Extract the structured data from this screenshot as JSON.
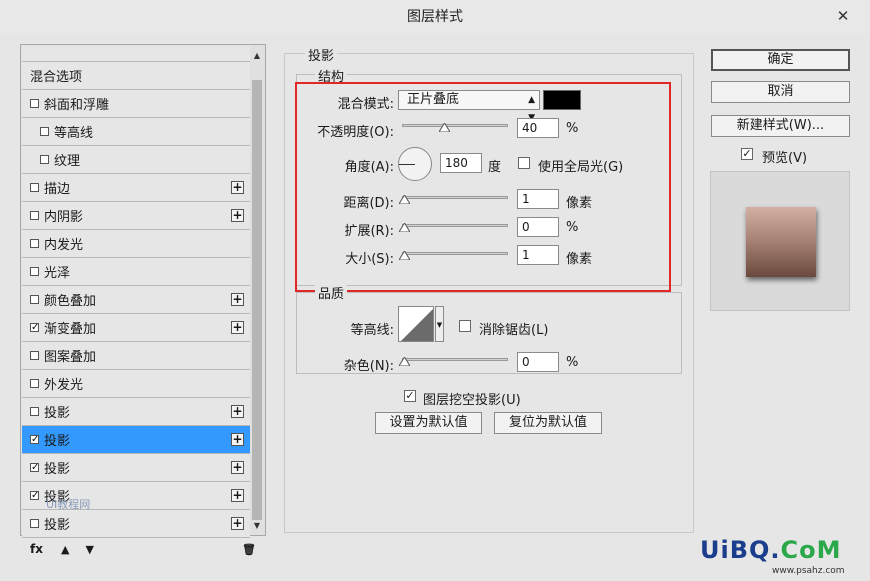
{
  "window": {
    "title": "图层样式",
    "close": "✕"
  },
  "left": {
    "items": [
      {
        "label": "混合选项",
        "checked": null,
        "indent": false,
        "plus": false
      },
      {
        "label": "斜面和浮雕",
        "checked": false,
        "indent": false,
        "plus": false
      },
      {
        "label": "等高线",
        "checked": false,
        "indent": true,
        "plus": false
      },
      {
        "label": "纹理",
        "checked": false,
        "indent": true,
        "plus": false
      },
      {
        "label": "描边",
        "checked": false,
        "indent": false,
        "plus": true
      },
      {
        "label": "内阴影",
        "checked": false,
        "indent": false,
        "plus": true
      },
      {
        "label": "内发光",
        "checked": false,
        "indent": false,
        "plus": false
      },
      {
        "label": "光泽",
        "checked": false,
        "indent": false,
        "plus": false
      },
      {
        "label": "颜色叠加",
        "checked": false,
        "indent": false,
        "plus": true
      },
      {
        "label": "渐变叠加",
        "checked": true,
        "indent": false,
        "plus": true
      },
      {
        "label": "图案叠加",
        "checked": false,
        "indent": false,
        "plus": false
      },
      {
        "label": "外发光",
        "checked": false,
        "indent": false,
        "plus": false
      },
      {
        "label": "投影",
        "checked": false,
        "indent": false,
        "plus": true
      },
      {
        "label": "投影",
        "checked": true,
        "indent": false,
        "plus": true,
        "selected": true
      },
      {
        "label": "投影",
        "checked": true,
        "indent": false,
        "plus": true
      },
      {
        "label": "投影",
        "checked": true,
        "indent": false,
        "plus": true
      },
      {
        "label": "投影",
        "checked": false,
        "indent": false,
        "plus": true
      }
    ],
    "footer": {
      "fx": "fx",
      "up": "▲",
      "down": "▼",
      "trash": "🗑"
    },
    "watermark": "UI教程网"
  },
  "main": {
    "section_title": "投影",
    "structure": {
      "title": "结构",
      "blend_mode_label": "混合模式:",
      "blend_mode_value": "正片叠底",
      "shadow_color": "#000000",
      "opacity_label": "不透明度(O):",
      "opacity_value": "40",
      "opacity_unit": "%",
      "angle_label": "角度(A):",
      "angle_value": "180",
      "angle_unit": "度",
      "global_light_label": "使用全局光(G)",
      "global_light_checked": false,
      "distance_label": "距离(D):",
      "distance_value": "1",
      "distance_unit": "像素",
      "spread_label": "扩展(R):",
      "spread_value": "0",
      "spread_unit": "%",
      "size_label": "大小(S):",
      "size_value": "1",
      "size_unit": "像素"
    },
    "quality": {
      "title": "品质",
      "contour_label": "等高线:",
      "antialias_label": "消除锯齿(L)",
      "antialias_checked": false,
      "noise_label": "杂色(N):",
      "noise_value": "0",
      "noise_unit": "%"
    },
    "knockout_label": "图层挖空投影(U)",
    "knockout_checked": true,
    "make_default": "设置为默认值",
    "reset_default": "复位为默认值"
  },
  "right": {
    "ok": "确定",
    "cancel": "取消",
    "new_style": "新建样式(W)...",
    "preview_label": "预览(V)",
    "preview_checked": true
  },
  "branding": {
    "logo_a": "UiBQ.",
    "logo_b": "CoM",
    "url": "www.psahz.com"
  },
  "colors": {
    "accent": "#3399ff",
    "highlight_box": "#e02828"
  }
}
